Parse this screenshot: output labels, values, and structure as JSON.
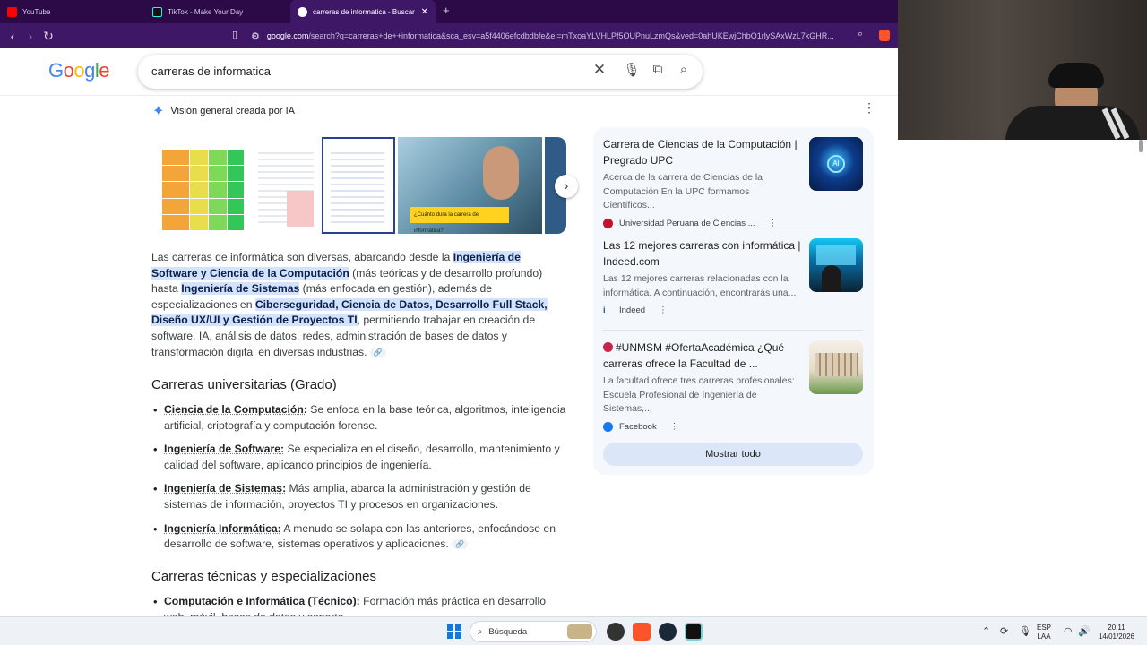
{
  "browser": {
    "tabs": [
      {
        "label": "YouTube",
        "active": false,
        "favicon_color": "#ff0000"
      },
      {
        "label": "TikTok - Make Your Day",
        "active": false,
        "favicon_color": "#111111"
      },
      {
        "label": "carreras de informatica - Buscar",
        "active": true,
        "favicon_color": "#ffffff"
      }
    ],
    "new_tab_icon": "plus-icon",
    "close_tab_icon": "close-icon",
    "url_domain": "google.com",
    "url_rest": "/search?q=carreras+de++informatica&sca_esv=a5f4406efcdbdbfe&ei=mTxoaYLVHLPf5OUPnuLzmQs&ved=0ahUKEwjChbO1rlySAxWzL7kGHR..."
  },
  "google": {
    "logo": "Google",
    "query": "carreras de informatica"
  },
  "ai_overview": {
    "label": "Visión general creada por IA",
    "thumb_caption": "¿Cuánto dura la carrera de informática?",
    "para_before": "Las carreras de informática son diversas, abarcando desde la ",
    "para_highlight": "Ingeniería de Software y Ciencia de la Computación",
    "para_mid1": " (más teóricas y de desarrollo profundo) hasta ",
    "para_highlight2": "Ingeniería de Sistemas",
    "para_mid2": " (más enfocada en gestión), además de especializaciones en ",
    "para_highlight3": "Ciberseguridad, Ciencia de Datos, Desarrollo Full Stack, Diseño UX/UI y Gestión de Proyectos TI",
    "para_after": ", permitiendo trabajar en creación de software, IA, análisis de datos, redes, administración de bases de datos y transformación digital en diversas industrias.",
    "section1_title": "Carreras universitarias (Grado)",
    "section1_items": [
      {
        "term": "Ciencia de la Computación:",
        "text": " Se enfoca en la base teórica, algoritmos, inteligencia artificial, criptografía y computación forense."
      },
      {
        "term": "Ingeniería de Software:",
        "text": " Se especializa en el diseño, desarrollo, mantenimiento y calidad del software, aplicando principios de ingeniería."
      },
      {
        "term": "Ingeniería de Sistemas:",
        "text": " Más amplia, abarca la administración y gestión de sistemas de información, proyectos TI y procesos en organizaciones."
      },
      {
        "term": "Ingeniería Informática:",
        "text": " A menudo se solapa con las anteriores, enfocándose en desarrollo de software, sistemas operativos y aplicaciones."
      }
    ],
    "section2_title": "Carreras técnicas y especializaciones",
    "section2_items": [
      {
        "term": "Computación e Informática (Técnico):",
        "text": " Formación más práctica en desarrollo web, móvil, bases de datos y soporte."
      }
    ]
  },
  "sources": [
    {
      "title": "Carrera de Ciencias de la Computación | Pregrado UPC",
      "desc": "Acerca de la carrera de Ciencias de la Computación En la UPC formamos Científicos...",
      "site": "Universidad Peruana de Ciencias ...",
      "site_color": "#c8102e"
    },
    {
      "title": "Las 12 mejores carreras con informática | Indeed.com",
      "desc": "Las 12 mejores carreras relacionadas con la informática. A continuación, encontrarás una...",
      "site": "Indeed",
      "site_color": "#2557a7"
    },
    {
      "title": "#UNMSM #OfertaAcadémica ¿Qué carreras ofrece la Facultad de ...",
      "desc": "La facultad ofrece tres carreras profesionales: Escuela Profesional de Ingeniería de Sistemas,...",
      "site": "Facebook",
      "site_color": "#1877f2"
    }
  ],
  "show_all": "Mostrar todo",
  "taskbar": {
    "search_label": "Búsqueda",
    "lang": "ESP",
    "lang2": "LAA",
    "time": "20:11",
    "date": "14/01/2026"
  }
}
